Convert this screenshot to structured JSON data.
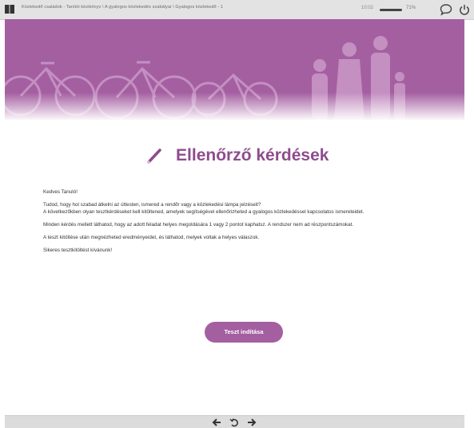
{
  "topbar": {
    "breadcrumb": "Közlekedő családok - Tanítói kézikönyv \\ A gyalogos közlekedés szabályai \\ Gyalogos közlekedő - 1",
    "time": "10:02",
    "zoom": "71%",
    "icons": [
      "book-icon",
      "comment-icon",
      "power-icon"
    ]
  },
  "main": {
    "title": "Ellenőrző kérdések",
    "greeting": "Kedves Tanuló!",
    "para1_line1": "Tudod, hogy hol szabad átkelni az úttesten, ismered a rendőr vagy a közlekedési lámpa jelzéseit?",
    "para1_line2": "A következőkben olyan tesztkérdéseket kell kitöltened, amelyek segítségével ellenőrizheted a gyalogos közlekedéssel kapcsolatos ismereteidet.",
    "para2": "Minden kérdés mellett láthatod, hogy az adott feladat helyes megoldására 1 vagy 2 pontot kaphatsz. A rendszer nem ad részpontszámokat.",
    "para3": "A teszt kitöltése után megnézheted eredményeidet, és láthatod, melyek voltak a helyes válaszok.",
    "closing": "Sikeres tesztkitöltést kívánunk!",
    "start_button": "Teszt indítása"
  },
  "colors": {
    "accent": "#a45fa1",
    "title": "#8e4c8d"
  }
}
